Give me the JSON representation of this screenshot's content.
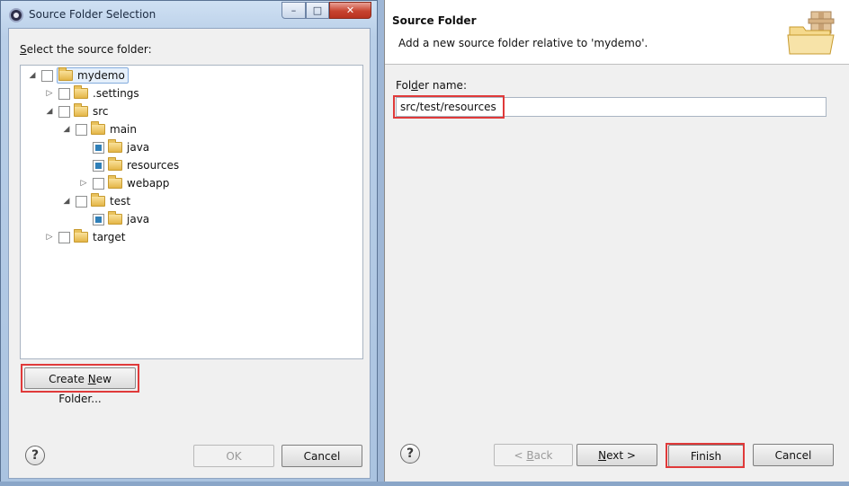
{
  "left_dialog": {
    "title": "Source Folder Selection",
    "title_icon": "eclipse-icon",
    "window_buttons": {
      "minimize": "–",
      "maximize": "□",
      "close": "✕"
    },
    "select_label_mnemonic": "S",
    "select_label_rest": "elect the source folder:",
    "tree": [
      {
        "label": "mydemo",
        "twisty": "◢",
        "checked": false,
        "selected": true
      },
      {
        "label": ".settings",
        "twisty": "▷",
        "checked": false
      },
      {
        "label": "src",
        "twisty": "◢",
        "checked": false
      },
      {
        "label": "main",
        "twisty": "◢",
        "checked": false
      },
      {
        "label": "java",
        "twisty": "",
        "checked": "partial"
      },
      {
        "label": "resources",
        "twisty": "",
        "checked": "partial"
      },
      {
        "label": "webapp",
        "twisty": "▷",
        "checked": false
      },
      {
        "label": "test",
        "twisty": "◢",
        "checked": false
      },
      {
        "label": "java",
        "twisty": "",
        "checked": "partial"
      },
      {
        "label": "target",
        "twisty": "▷",
        "checked": false
      }
    ],
    "create_button_prefix": "Create ",
    "create_button_mnemonic": "N",
    "create_button_suffix": "ew Folder...",
    "help_label": "?",
    "ok_label": "OK",
    "cancel_label": "Cancel"
  },
  "right_dialog": {
    "title": "Source Folder",
    "description": "Add a new source folder relative to 'mydemo'.",
    "folder_label_prefix": "Fol",
    "folder_label_mnemonic": "d",
    "folder_label_suffix": "er name:",
    "folder_value": "src/test/resources",
    "help_label": "?",
    "back_prefix": "< ",
    "back_mnemonic": "B",
    "back_suffix": "ack",
    "next_mnemonic": "N",
    "next_suffix": "ext >",
    "finish_label": "Finish",
    "cancel_label": "Cancel"
  },
  "colors": {
    "highlight": "#e03a3a",
    "selection_bg": "#e6f0fb",
    "selection_border": "#84acdd"
  }
}
